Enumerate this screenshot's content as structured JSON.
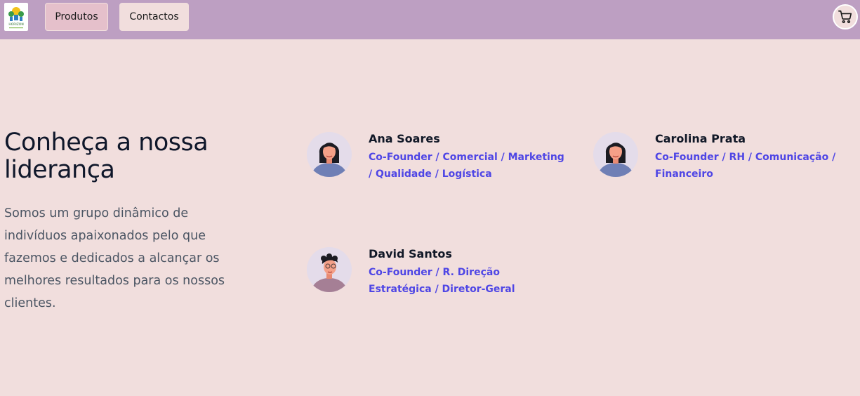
{
  "navbar": {
    "logo_text": "HORIZON",
    "buttons": [
      {
        "label": "Produtos"
      },
      {
        "label": "Contactos"
      }
    ],
    "cart_icon": "cart-icon"
  },
  "hero": {
    "title": "Conheça a nossa liderança",
    "description": "Somos um grupo dinâmico de indivíduos apaixonados pelo que fazemos e dedicados a alcançar os melhores resultados para os nossos clientes."
  },
  "team": [
    {
      "name": "Ana Soares",
      "role": "Co-Founder / Comercial / Marketing / Qualidade / Logística",
      "avatar": "woman-avatar-icon"
    },
    {
      "name": "Carolina Prata",
      "role": "Co-Founder / RH / Comunicação / Financeiro",
      "avatar": "woman-avatar-icon"
    },
    {
      "name": "David Santos",
      "role": "Co-Founder / R. Direção Estratégica / Diretor-Geral",
      "avatar": "man-avatar-icon"
    }
  ],
  "colors": {
    "navbar": "#bd9fc2",
    "background": "#f1dedd",
    "role_text": "#4f46e5",
    "active_button": "#e5c0cb"
  }
}
